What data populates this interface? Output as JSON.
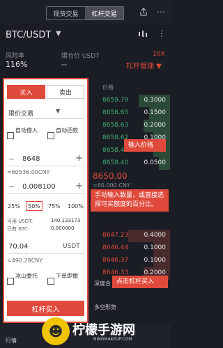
{
  "tabs": [
    {
      "label": "现货交易"
    },
    {
      "label": "杠杆交易"
    }
  ],
  "pair": {
    "name": "BTC/USDT",
    "caret": "▼"
  },
  "risk": {
    "label": "风险率",
    "value": "116%",
    "liq_label": "爆仓价 USDT",
    "liq_value": "--",
    "leverage": "10X",
    "manage": "杠杆管理 ▼"
  },
  "book": {
    "price_header": "价格",
    "asks": [
      {
        "price": "8659.79",
        "qty": "0.3000"
      },
      {
        "price": "8658.65",
        "qty": "0.1500"
      },
      {
        "price": "8658.63",
        "qty": "0.2000"
      },
      {
        "price": "8658.62",
        "qty": "0.1000"
      },
      {
        "price": "8658.42",
        "qty": "0.1000"
      },
      {
        "price": "8658.40",
        "qty": "0.0500"
      }
    ],
    "mid": "8650.00",
    "mid_sub": "≈60.000 CNY",
    "bids": [
      {
        "price": "8647.23",
        "qty": "0.4000"
      },
      {
        "price": "8646.44",
        "qty": "0.1000"
      },
      {
        "price": "8646.37",
        "qty": "0.1000"
      },
      {
        "price": "8646.33",
        "qty": "0.2000"
      }
    ],
    "depth_label": "深度合",
    "more_label": "多空形势"
  },
  "form": {
    "buy": "买入",
    "sell": "卖出",
    "order_type": "限价交易",
    "auto_borrow": "自动借入",
    "auto_repay": "自动还款",
    "price": "8648",
    "price_cny": "≈60536.00CNY",
    "amount": "0.008100",
    "pcts": [
      "25%",
      "50%",
      "75%",
      "100%"
    ],
    "avail_label": "可用 USDT:",
    "avail_value": "140.133173",
    "borrowed_label": "已有 BTC:",
    "borrowed_value": "0.000000",
    "total": "70.04",
    "total_unit": "USDT",
    "total_cny": "≈490.28CNY",
    "iceberg": "冰山委托",
    "place_now": "下单即撤",
    "submit": "杠杆买入"
  },
  "callouts": {
    "price": "输入价格",
    "amount": "手动输入数量，或直接选择可买额度的百分比。",
    "buy": "点击杠杆买入"
  },
  "bottom": {
    "trade": "行情"
  },
  "watermark": {
    "name": "柠檬手游网",
    "url": "NINGMAKEUP.COM"
  },
  "colors": {
    "accent": "#e04a3c",
    "green": "#3fae73",
    "buy_bg": "#e7f1ea",
    "sell_bg": "#f6e7e4"
  }
}
